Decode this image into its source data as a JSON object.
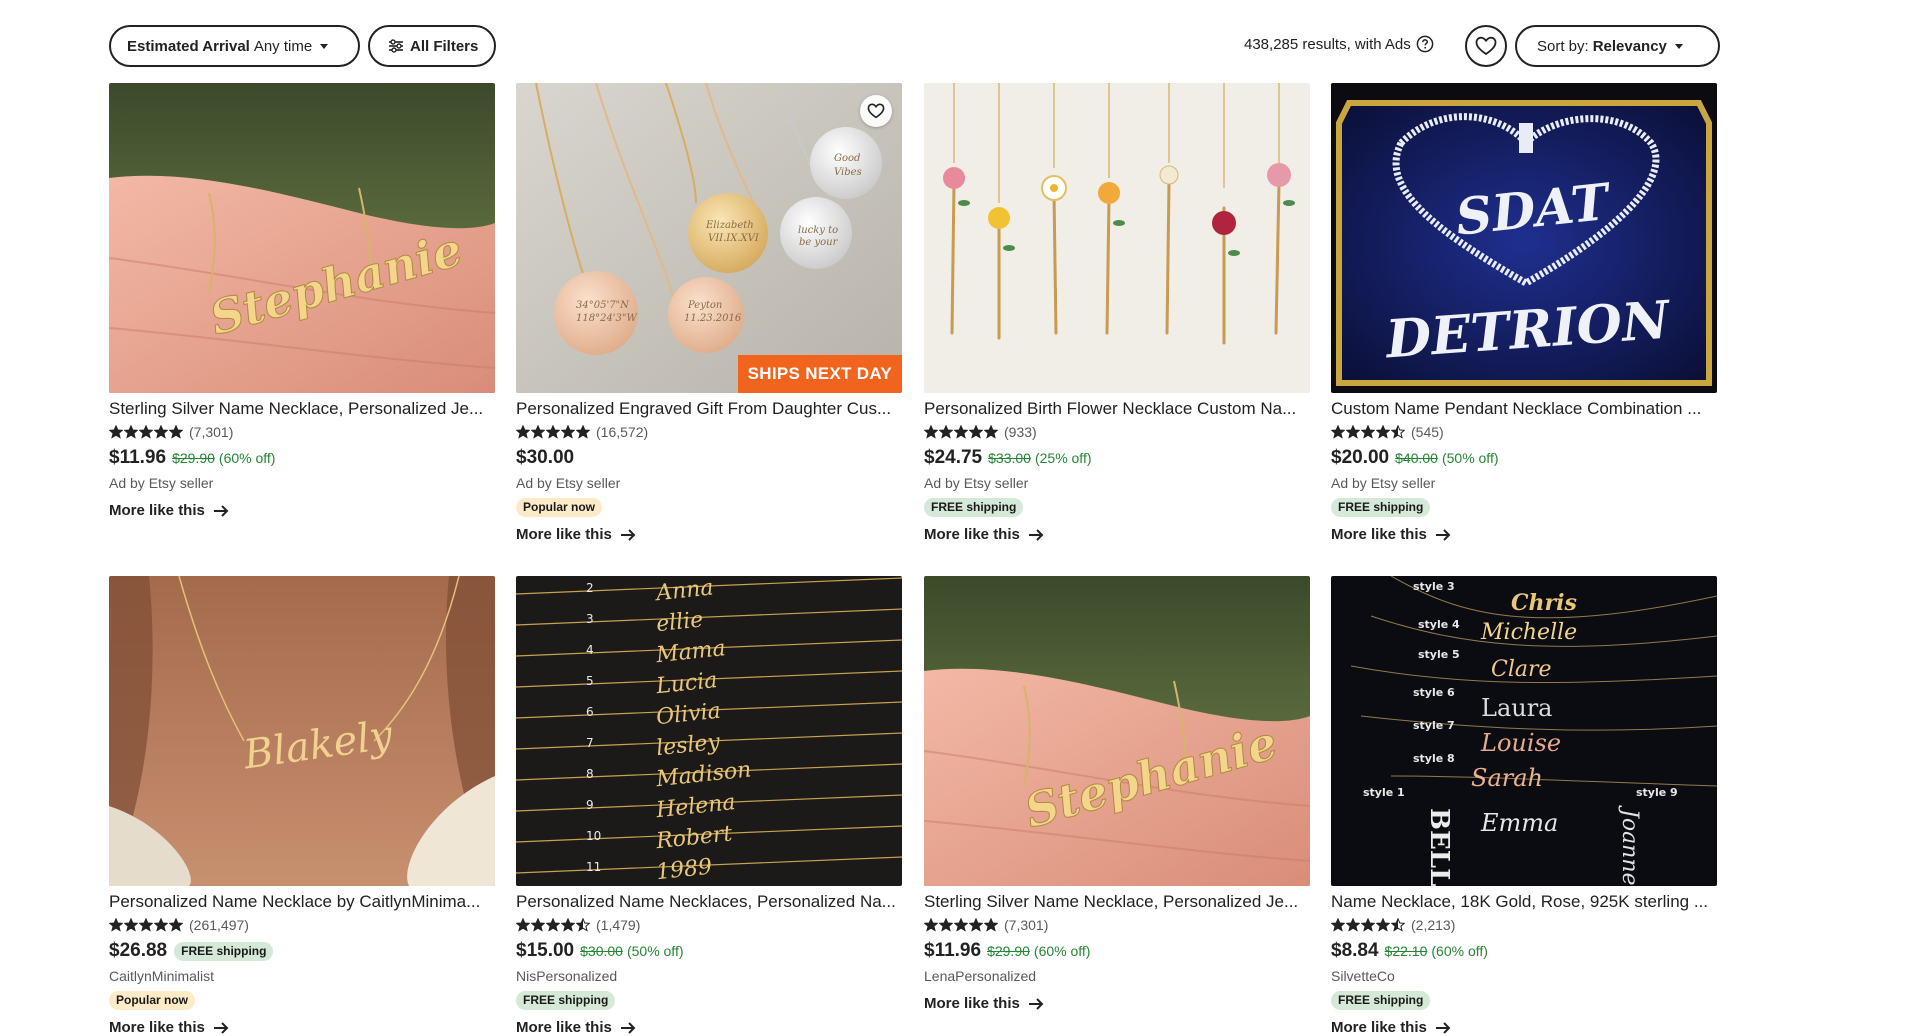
{
  "toolbar": {
    "arrival_label": "Estimated Arrival",
    "arrival_value": "Any time",
    "filters_label": "All Filters",
    "results_text": "438,285 results, with Ads",
    "sort_label": "Sort by:",
    "sort_value": "Relevancy",
    "icons": [
      "caret-down-icon",
      "filters-icon",
      "help-icon",
      "heart-icon"
    ]
  },
  "colors": {
    "sale_green": "#258635",
    "ships_badge": "#f1641e",
    "free_shipping_bg": "#d4e9d7",
    "popular_bg": "#fdebc8"
  },
  "listings": [
    {
      "title": "Sterling Silver Name Necklace, Personalized Je...",
      "rating": 5,
      "reviews": "(7,301)",
      "price": "$11.96",
      "original_price": "$29.90",
      "discount": "(60% off)",
      "seller": "Ad by Etsy seller",
      "badge": "",
      "inline_badge": "",
      "more": "More like this",
      "image_text": "Stephanie"
    },
    {
      "title": "Personalized Engraved Gift From Daughter Cus...",
      "rating": 5,
      "reviews": "(16,572)",
      "price": "$30.00",
      "original_price": "",
      "discount": "",
      "seller": "Ad by Etsy seller",
      "badge": "Popular now",
      "inline_badge": "",
      "more": "More like this",
      "image_banner": "SHIPS NEXT DAY"
    },
    {
      "title": "Personalized Birth Flower Necklace Custom Na...",
      "rating": 5,
      "reviews": "(933)",
      "price": "$24.75",
      "original_price": "$33.00",
      "discount": "(25% off)",
      "seller": "Ad by Etsy seller",
      "badge": "FREE shipping",
      "inline_badge": "",
      "more": "More like this"
    },
    {
      "title": "Custom Name Pendant Necklace Combination ...",
      "rating": 4.5,
      "reviews": "(545)",
      "price": "$20.00",
      "original_price": "$40.00",
      "discount": "(50% off)",
      "seller": "Ad by Etsy seller",
      "badge": "FREE shipping",
      "inline_badge": "",
      "more": "More like this",
      "image_text": [
        "SDAT",
        "DETRION"
      ]
    },
    {
      "title": "Personalized Name Necklace by CaitlynMinima...",
      "rating": 5,
      "reviews": "(261,497)",
      "price": "$26.88",
      "original_price": "",
      "discount": "",
      "seller": "CaitlynMinimalist",
      "badge": "Popular now",
      "inline_badge": "FREE shipping",
      "more": "More like this",
      "image_text": "Blakely"
    },
    {
      "title": "Personalized Name Necklaces, Personalized Na...",
      "rating": 4.5,
      "reviews": "(1,479)",
      "price": "$15.00",
      "original_price": "$30.00",
      "discount": "(50% off)",
      "seller": "NisPersonalized",
      "badge": "FREE shipping",
      "inline_badge": "",
      "more": "More like this",
      "image_list": [
        {
          "n": "2",
          "name": "Anna"
        },
        {
          "n": "3",
          "name": "ellie"
        },
        {
          "n": "4",
          "name": "Mama"
        },
        {
          "n": "5",
          "name": "Lucia"
        },
        {
          "n": "6",
          "name": "Olivia"
        },
        {
          "n": "7",
          "name": "lesley"
        },
        {
          "n": "8",
          "name": "Madison"
        },
        {
          "n": "9",
          "name": "Helena"
        },
        {
          "n": "10",
          "name": "Robert"
        },
        {
          "n": "11",
          "name": "1989"
        }
      ]
    },
    {
      "title": "Sterling Silver Name Necklace, Personalized Je...",
      "rating": 5,
      "reviews": "(7,301)",
      "price": "$11.96",
      "original_price": "$29.90",
      "discount": "(60% off)",
      "seller": "LenaPersonalized",
      "badge": "",
      "inline_badge": "",
      "more": "More like this",
      "image_text": "Stephanie"
    },
    {
      "title": "Name Necklace, 18K Gold, Rose, 925K sterling ...",
      "rating": 4.5,
      "reviews": "(2,213)",
      "price": "$8.84",
      "original_price": "$22.10",
      "discount": "(60% off)",
      "seller": "SilvetteCo",
      "badge": "FREE shipping",
      "inline_badge": "",
      "more": "More like this",
      "image_styles": [
        {
          "style": "style 3",
          "name": "Chris"
        },
        {
          "style": "style 4",
          "name": "Michelle"
        },
        {
          "style": "style 5",
          "name": "Clare"
        },
        {
          "style": "style 6",
          "name": "Laura"
        },
        {
          "style": "style 7",
          "name": "Louise"
        },
        {
          "style": "style 8",
          "name": "Sarah"
        },
        {
          "style": "",
          "name": "Emma"
        },
        {
          "style": "style 1",
          "name": "BELLA"
        },
        {
          "style": "style 9",
          "name": "Joanne"
        }
      ]
    }
  ]
}
